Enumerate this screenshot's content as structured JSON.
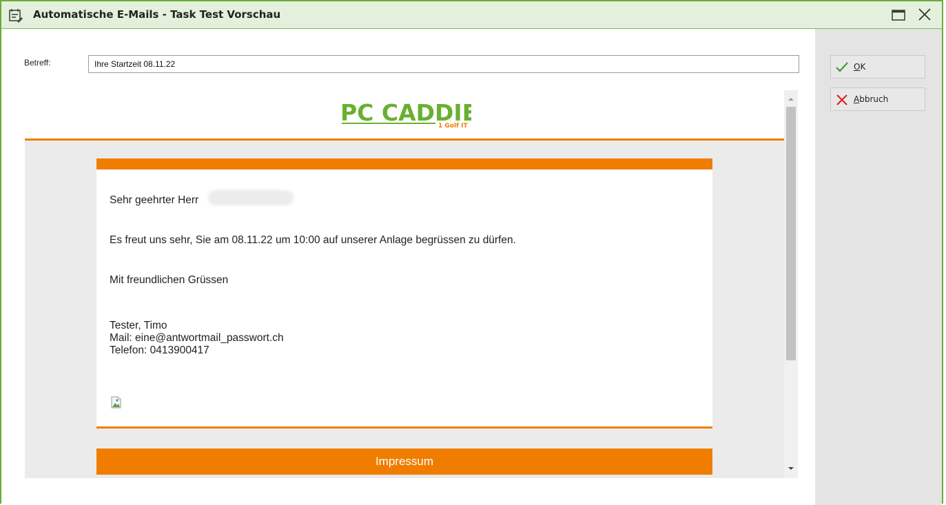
{
  "window": {
    "title": "Automatische E-Mails - Task Test Vorschau",
    "icons": {
      "title": "calendar-edit-icon",
      "maximize": "maximize-icon",
      "close": "close-icon"
    },
    "border_color": "#6aaa3a",
    "titlebar_color": "#e3f1dc"
  },
  "form": {
    "subject_label": "Betreff:",
    "subject_value": "Ihre Startzeit 08.11.22"
  },
  "preview": {
    "logo": {
      "brand": "PC CADDIE",
      "tagline": "1 Golf IT"
    },
    "accent_color": "#f07d00",
    "greeting": "Sehr geehrter Herr",
    "body_line": "Es freut uns sehr, Sie am 08.11.22 um 10:00 auf unserer Anlage begrüssen zu dürfen.",
    "closing": "Mit freundlichen Grüssen",
    "signature": {
      "name": "Tester, Timo",
      "mail": "Mail: eine@antwortmail_passwort.ch",
      "phone": "Telefon: 0413900417"
    },
    "footer": "Impressum"
  },
  "actions": {
    "ok_label": "K",
    "ok_mnemonic": "O",
    "cancel_label": "bbruch",
    "cancel_mnemonic": "A",
    "icons": {
      "ok": "checkmark-icon",
      "cancel": "cross-icon"
    }
  }
}
